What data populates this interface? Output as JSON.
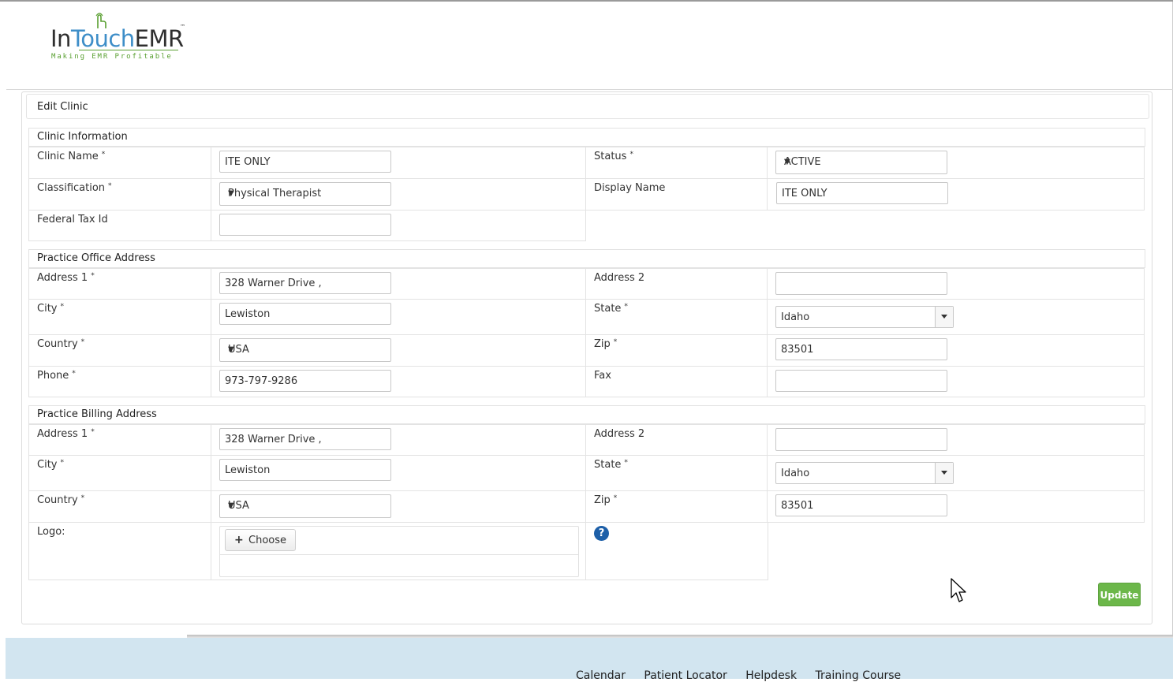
{
  "logo": {
    "brand_part1": "In",
    "brand_part2": "Touch",
    "brand_part3": "EMR",
    "trademark": "™",
    "tagline": "Making EMR Profitable"
  },
  "page": {
    "title": "Edit Clinic"
  },
  "clinic_info": {
    "section_title": "Clinic Information",
    "clinic_name_label": "Clinic Name",
    "clinic_name_value": "ITE ONLY",
    "status_label": "Status",
    "status_value": "ACTIVE",
    "classification_label": "Classification",
    "classification_value": "Physical Therapist",
    "display_name_label": "Display Name",
    "display_name_value": "ITE ONLY",
    "federal_tax_label": "Federal Tax Id",
    "federal_tax_value": ""
  },
  "office_address": {
    "section_title": "Practice Office Address",
    "address1_label": "Address 1",
    "address1_value": "328 Warner Drive ,",
    "address2_label": "Address 2",
    "address2_value": "",
    "city_label": "City",
    "city_value": "Lewiston",
    "state_label": "State",
    "state_value": "Idaho",
    "country_label": "Country",
    "country_value": "USA",
    "zip_label": "Zip",
    "zip_value": "83501",
    "phone_label": "Phone",
    "phone_value": "973-797-9286",
    "fax_label": "Fax",
    "fax_value": ""
  },
  "billing_address": {
    "section_title": "Practice Billing Address",
    "address1_label": "Address 1",
    "address1_value": "328 Warner Drive ,",
    "address2_label": "Address 2",
    "address2_value": "",
    "city_label": "City",
    "city_value": "Lewiston",
    "state_label": "State",
    "state_value": "Idaho",
    "country_label": "Country",
    "country_value": "USA",
    "zip_label": "Zip",
    "zip_value": "83501",
    "logo_label": "Logo:",
    "choose_label": "Choose",
    "help_icon": "question-circle-icon"
  },
  "required_marker": "*",
  "actions": {
    "update_label": "Update"
  },
  "footer": {
    "links": [
      "Calendar",
      "Patient Locator",
      "Helpdesk",
      "Training Course"
    ]
  },
  "colors": {
    "accent_green": "#6cb74a",
    "brand_blue": "#3e8ec8",
    "tagline_green": "#5aa032",
    "footer_bg": "#d2e5f0",
    "help_blue": "#1d5fa8"
  }
}
